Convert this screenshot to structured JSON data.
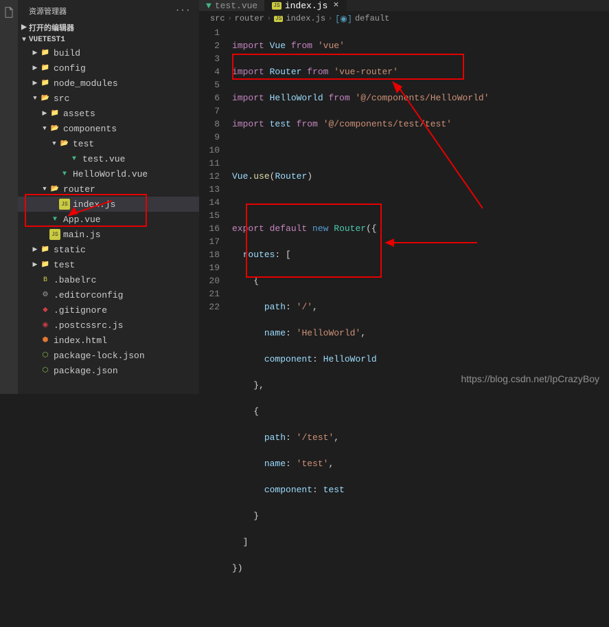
{
  "sidebar": {
    "title": "资源管理器",
    "open_editors": "打开的编辑器",
    "project": "VUETEST1",
    "tree": {
      "build": "build",
      "config": "config",
      "node_modules": "node_modules",
      "src": "src",
      "assets": "assets",
      "components": "components",
      "test": "test",
      "test_vue": "test.vue",
      "helloworld": "HelloWorld.vue",
      "router": "router",
      "index_js": "index.js",
      "app_vue": "App.vue",
      "main_js": "main.js",
      "static": "static",
      "test_folder": "test",
      "babelrc": ".babelrc",
      "editorconfig": ".editorconfig",
      "gitignore": ".gitignore",
      "postcssrc": ".postcssrc.js",
      "index_html": "index.html",
      "package_lock": "package-lock.json",
      "package_json": "package.json"
    }
  },
  "tabs": {
    "test_vue": "test.vue",
    "index_js": "index.js"
  },
  "breadcrumb": {
    "src": "src",
    "router": "router",
    "index_js": "index.js",
    "default": "default"
  },
  "code": {
    "line1": "import Vue from 'vue'",
    "line2": "import Router from 'vue-router'",
    "line3": "import HelloWorld from '@/components/HelloWorld'",
    "line4": "import test from '@/components/test/test'",
    "line6": "Vue.use(Router)",
    "line8": "export default new Router({",
    "line9": "  routes: [",
    "line10": "    {",
    "line11": "      path: '/',",
    "line12": "      name: 'HelloWorld',",
    "line13": "      component: HelloWorld",
    "line14": "    },",
    "line15": "    {",
    "line16": "      path: '/test',",
    "line17": "      name: 'test',",
    "line18": "      component: test",
    "line19": "    }",
    "line20": "  ]",
    "line21": "})"
  },
  "watermark": "https://blog.csdn.net/IpCrazyBoy"
}
